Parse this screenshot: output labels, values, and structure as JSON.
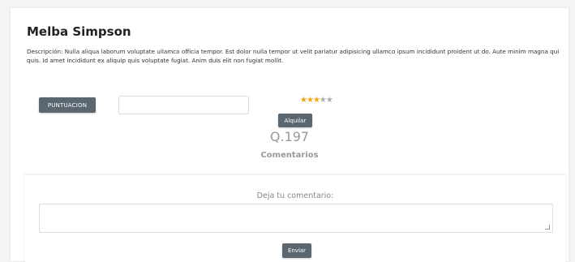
{
  "profile": {
    "name": "Melba Simpson",
    "description": "Descripción: Nulla aliqua laborum voluptate ullamco officia tempor. Est dolor nulla tempor ut velit pariatur adipisicing ullamco ipsum incididunt proident ut do. Aute minim magna qui quis. Id amet incididunt ex aliquip quis voluptate fugiat. Anim duis elit non fugiat mollit."
  },
  "rating": {
    "button_label": "PUNTUACION",
    "input_value": "",
    "stars_filled": 3,
    "stars_total": 5
  },
  "rent": {
    "button_label": "Alquilar",
    "price": "Q.197"
  },
  "comments": {
    "title": "Comentarios",
    "form_heading": "Deja tu comentario:",
    "textarea_value": "",
    "send_label": "Enviar"
  },
  "colors": {
    "button_bg": "#5b6770",
    "star_filled": "#f0a500",
    "star_empty": "#aaaaaa",
    "muted_text": "#999999"
  }
}
